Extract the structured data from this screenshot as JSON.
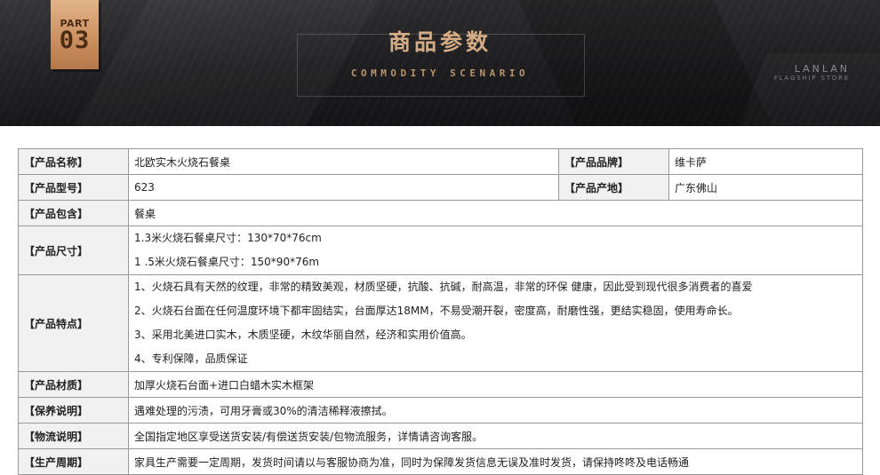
{
  "banner": {
    "part_word": "PART",
    "part_number": "03",
    "title_cn": "商品参数",
    "title_en": "COMMODITY SCENARIO",
    "store_name": "LANLAN",
    "store_sub": "FLAGSHIP STORE"
  },
  "params": {
    "name": {
      "label": "【产品名称】",
      "value": "北欧实木火烧石餐桌"
    },
    "brand": {
      "label": "【产品品牌】",
      "value": "维卡萨"
    },
    "model": {
      "label": "【产品型号】",
      "value": "623"
    },
    "origin": {
      "label": "【产品产地】",
      "value": "广东佛山"
    },
    "contents": {
      "label": "【产品包含】",
      "value": "餐桌"
    },
    "size": {
      "label": "【产品尺寸】",
      "lines": [
        "1.3米火烧石餐桌尺寸：130*70*76cm",
        "1 .5米火烧石餐桌尺寸：150*90*76m"
      ]
    },
    "features": {
      "label": "【产品特点】",
      "lines": [
        "1、火烧石具有天然的纹理，非常的精致美观，材质坚硬，抗酸、抗碱，耐高温，非常的环保 健康，因此受到现代很多消费者的喜爱",
        "2、火烧石台面在任何温度环境下都牢固结实，台面厚达18MM，不易受潮开裂，密度高，耐磨性强，更结实稳固，使用寿命长。",
        "3、采用北美进口实木，木质坚硬，木纹华丽自然，经济和实用价值高。",
        "4、专利保障，品质保证"
      ]
    },
    "material": {
      "label": "【产品材质】",
      "value": "加厚火烧石台面+进口白蜡木实木框架"
    },
    "care": {
      "label": "【保养说明】",
      "value": "遇难处理的污渍，可用牙膏或30%的清洁稀释液擦拭。"
    },
    "logistics": {
      "label": "【物流说明】",
      "value": "全国指定地区享受送货安装/有偿送货安装/包物流服务，详情请咨询客服。"
    },
    "cycle": {
      "label": "【生产周期】",
      "value": "家具生产需要一定周期，发货时间请以与客服协商为准，同时为保障发货信息无误及准时发货，请保持咚咚及电话畅通"
    }
  }
}
